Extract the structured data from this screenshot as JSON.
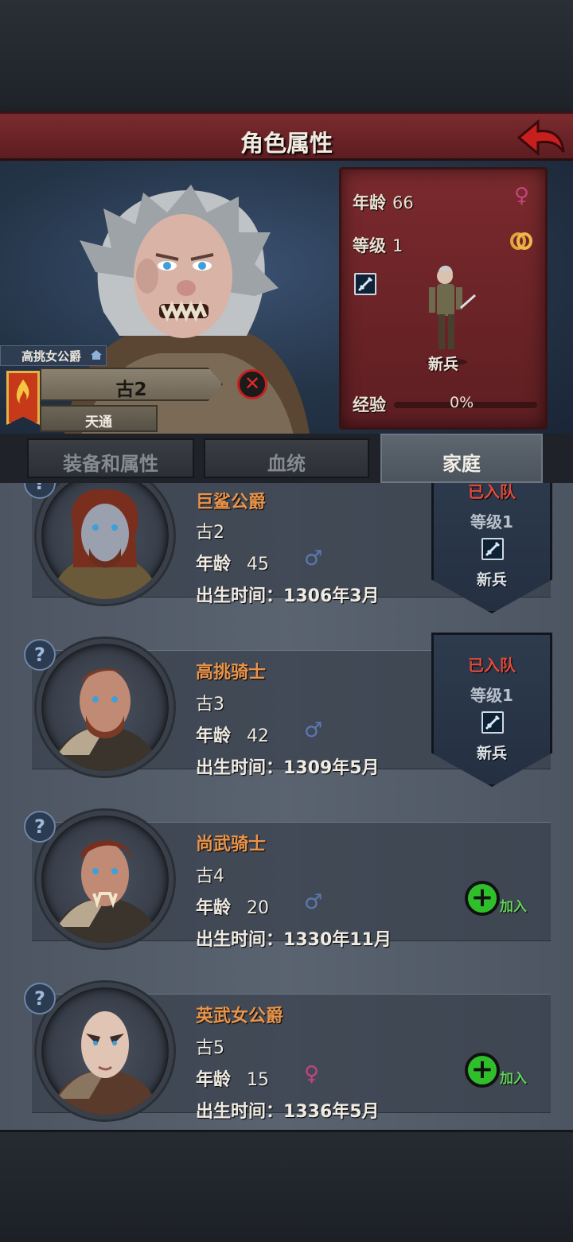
{
  "header": {
    "title": "角色属性"
  },
  "hero": {
    "title_tag": "高挑女公爵",
    "name": "古2",
    "dynasty": "天通",
    "stats": {
      "age_label": "年龄",
      "age": "66",
      "level_label": "等级",
      "level": "1",
      "rank": "新兵",
      "xp_label": "经验",
      "xp_value": "0%",
      "xp_fraction": 0
    }
  },
  "tabs": [
    {
      "label": "装备和属性"
    },
    {
      "label": "血统"
    },
    {
      "label": "家庭"
    }
  ],
  "members": [
    {
      "title": "巨鲨公爵",
      "name": "古2",
      "age_label": "年龄",
      "age": "45",
      "gender": "male",
      "birth_label": "出生时间：",
      "birth": "1306年3月",
      "status": "已入队",
      "level_text": "等级1",
      "rank": "新兵"
    },
    {
      "title": "高挑骑士",
      "name": "古3",
      "age_label": "年龄",
      "age": "42",
      "gender": "male",
      "birth_label": "出生时间：",
      "birth": "1309年5月",
      "status": "已入队",
      "level_text": "等级1",
      "rank": "新兵"
    },
    {
      "title": "尚武骑士",
      "name": "古4",
      "age_label": "年龄",
      "age": "20",
      "gender": "male",
      "birth_label": "出生时间：",
      "birth": "1330年11月",
      "join_label": "加入"
    },
    {
      "title": "英武女公爵",
      "name": "古5",
      "age_label": "年龄",
      "age": "15",
      "gender": "female",
      "birth_label": "出生时间：",
      "birth": "1336年5月",
      "join_label": "加入"
    }
  ],
  "colors": {
    "header_red": "#7b2b2e",
    "title_orange": "#e9944a",
    "status_red": "#e14a3a",
    "male_blue": "#5b78b0",
    "female_pink": "#c2457f",
    "join_green": "#2fbf2a"
  },
  "icons": [
    "back-arrow-icon",
    "female-icon",
    "male-icon",
    "ring-icon",
    "sword-icon",
    "home-icon",
    "flame-banner-icon",
    "close-icon",
    "help-icon",
    "plus-icon"
  ]
}
